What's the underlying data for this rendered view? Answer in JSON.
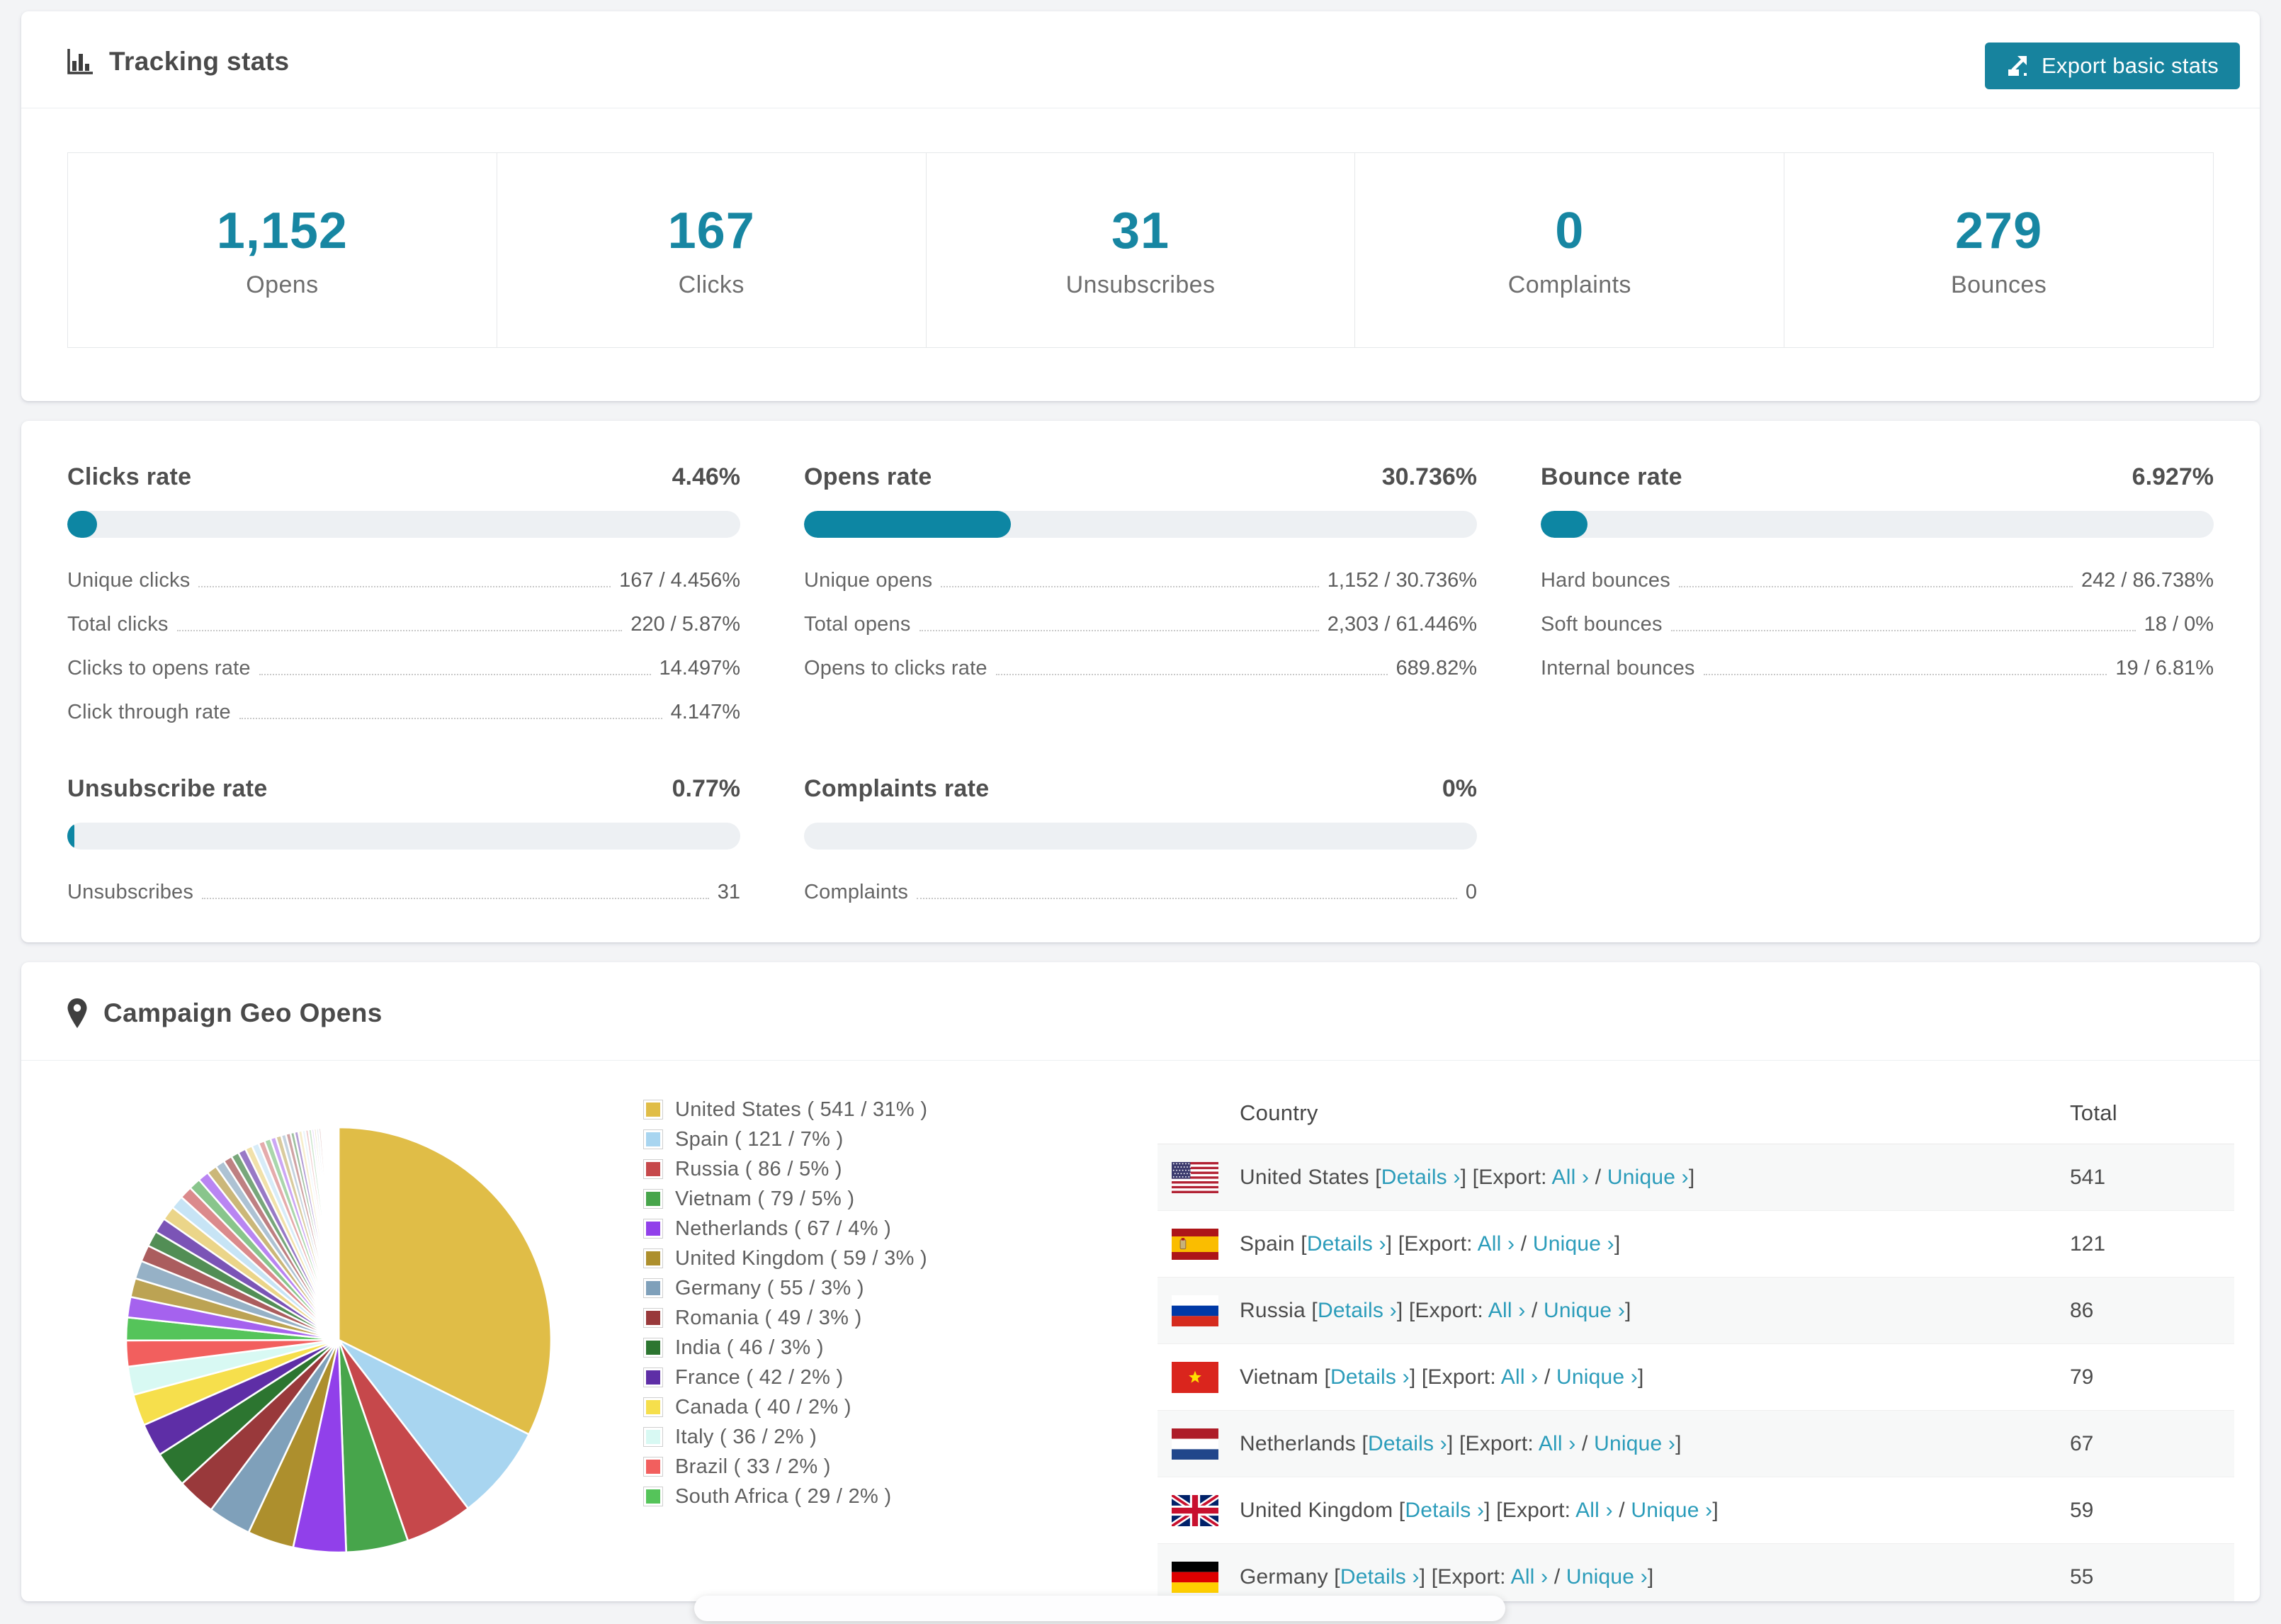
{
  "colors": {
    "accent_teal": "#1786a2",
    "button_teal": "#17839e",
    "link_teal": "#2b9cba",
    "bar_fill": "#0d86a3",
    "bar_track": "#edf0f3",
    "page_bg": "#f3f4f6"
  },
  "tracking": {
    "title": "Tracking stats",
    "export_label": "Export basic stats",
    "stats": [
      {
        "value": "1,152",
        "label": "Opens"
      },
      {
        "value": "167",
        "label": "Clicks"
      },
      {
        "value": "31",
        "label": "Unsubscribes"
      },
      {
        "value": "0",
        "label": "Complaints"
      },
      {
        "value": "279",
        "label": "Bounces"
      }
    ]
  },
  "rates": {
    "blocks": [
      {
        "title": "Clicks rate",
        "value": "4.46%",
        "pct": 4.46,
        "rows": [
          {
            "label": "Unique clicks",
            "value": "167 / 4.456%"
          },
          {
            "label": "Total clicks",
            "value": "220 / 5.87%"
          },
          {
            "label": "Clicks to opens rate",
            "value": "14.497%"
          },
          {
            "label": "Click through rate",
            "value": "4.147%"
          }
        ]
      },
      {
        "title": "Opens rate",
        "value": "30.736%",
        "pct": 30.736,
        "rows": [
          {
            "label": "Unique opens",
            "value": "1,152 / 30.736%"
          },
          {
            "label": "Total opens",
            "value": "2,303 / 61.446%"
          },
          {
            "label": "Opens to clicks rate",
            "value": "689.82%"
          }
        ]
      },
      {
        "title": "Bounce rate",
        "value": "6.927%",
        "pct": 6.927,
        "rows": [
          {
            "label": "Hard bounces",
            "value": "242 / 86.738%"
          },
          {
            "label": "Soft bounces",
            "value": "18 / 0%"
          },
          {
            "label": "Internal bounces",
            "value": "19 / 6.81%"
          }
        ]
      },
      {
        "title": "Unsubscribe rate",
        "value": "0.77%",
        "pct": 0.77,
        "rows": [
          {
            "label": "Unsubscribes",
            "value": "31"
          }
        ]
      },
      {
        "title": "Complaints rate",
        "value": "0%",
        "pct": 0,
        "rows": [
          {
            "label": "Complaints",
            "value": "0"
          }
        ]
      }
    ]
  },
  "geo": {
    "title": "Campaign Geo Opens",
    "table": {
      "headers": [
        "Country",
        "Total"
      ],
      "labels": {
        "details": "Details",
        "export": "Export:",
        "all": "All",
        "unique": "Unique",
        "arrow": "›"
      },
      "rows": [
        {
          "name": "United States",
          "flag": "us",
          "total": "541"
        },
        {
          "name": "Spain",
          "flag": "es",
          "total": "121"
        },
        {
          "name": "Russia",
          "flag": "ru",
          "total": "86"
        },
        {
          "name": "Vietnam",
          "flag": "vn",
          "total": "79"
        },
        {
          "name": "Netherlands",
          "flag": "nl",
          "total": "67"
        },
        {
          "name": "United Kingdom",
          "flag": "gb",
          "total": "59"
        },
        {
          "name": "Germany",
          "flag": "de",
          "total": "55"
        }
      ]
    }
  },
  "chart_data": {
    "type": "pie",
    "title": "Campaign Geo Opens",
    "legend_position": "right",
    "start_angle_deg": -90,
    "direction": "clockwise",
    "series": [
      {
        "name": "United States",
        "value": 541,
        "pct": 31,
        "color": "#E0BD47"
      },
      {
        "name": "Spain",
        "value": 121,
        "pct": 7,
        "color": "#A8D5F0"
      },
      {
        "name": "Russia",
        "value": 86,
        "pct": 5,
        "color": "#C6484B"
      },
      {
        "name": "Vietnam",
        "value": 79,
        "pct": 5,
        "color": "#47A54B"
      },
      {
        "name": "Netherlands",
        "value": 67,
        "pct": 4,
        "color": "#9140EA"
      },
      {
        "name": "United Kingdom",
        "value": 59,
        "pct": 3,
        "color": "#AD8F2D"
      },
      {
        "name": "Germany",
        "value": 55,
        "pct": 3,
        "color": "#7FA0BA"
      },
      {
        "name": "Romania",
        "value": 49,
        "pct": 3,
        "color": "#99393B"
      },
      {
        "name": "India",
        "value": 46,
        "pct": 3,
        "color": "#2C7530"
      },
      {
        "name": "France",
        "value": 42,
        "pct": 2,
        "color": "#5E2EA6"
      },
      {
        "name": "Canada",
        "value": 40,
        "pct": 2,
        "color": "#F6DF4C"
      },
      {
        "name": "Italy",
        "value": 36,
        "pct": 2,
        "color": "#D8F9F3"
      },
      {
        "name": "Brazil",
        "value": 33,
        "pct": 2,
        "color": "#F25F5E"
      },
      {
        "name": "South Africa",
        "value": 29,
        "pct": 2,
        "color": "#55C45A"
      }
    ],
    "palette_base": [
      "#E0BD47",
      "#A8D5F0",
      "#C6484B",
      "#47A54B",
      "#9140EA",
      "#AD8F2D",
      "#7FA0BA",
      "#99393B",
      "#2C7530",
      "#5E2EA6"
    ],
    "tail_lighten_step": 0.18,
    "tail_values": [
      26,
      24,
      23,
      21,
      20,
      19,
      18,
      17,
      16,
      15,
      14,
      13,
      12,
      11,
      10,
      10,
      9,
      9,
      8,
      8,
      7,
      7,
      6,
      6,
      5,
      5,
      5,
      4,
      4,
      4,
      3,
      3,
      3,
      3,
      2,
      2,
      2,
      2,
      2,
      2,
      1,
      1,
      1,
      1,
      1,
      1,
      1,
      1,
      1,
      1
    ]
  }
}
